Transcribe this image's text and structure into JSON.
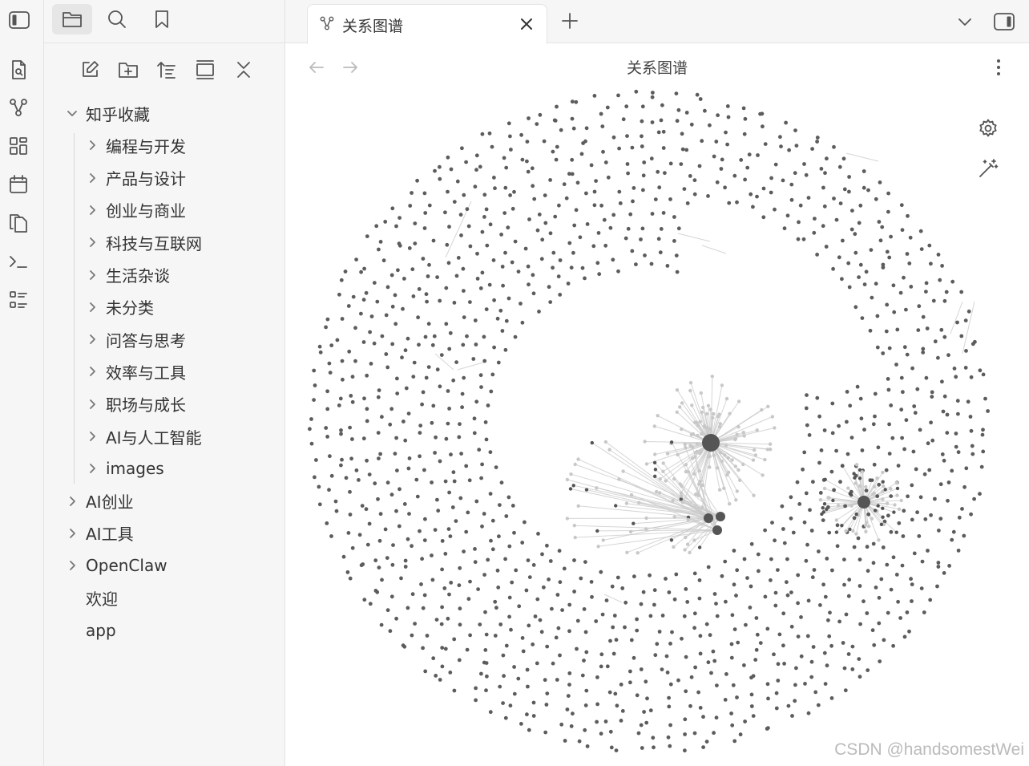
{
  "tab": {
    "title": "关系图谱"
  },
  "view": {
    "title": "关系图谱"
  },
  "sidebar": {
    "tabs": [
      {
        "icon": "folder-icon",
        "active": true
      },
      {
        "icon": "search-icon",
        "active": false
      },
      {
        "icon": "bookmark-icon",
        "active": false
      }
    ],
    "actions": [
      "new-note-icon",
      "new-folder-icon",
      "sort-icon",
      "collapse-view-icon",
      "collapse-all-icon"
    ],
    "tree": [
      {
        "label": "知乎收藏",
        "depth": 0,
        "expanded": true
      },
      {
        "label": "编程与开发",
        "depth": 1
      },
      {
        "label": "产品与设计",
        "depth": 1
      },
      {
        "label": "创业与商业",
        "depth": 1
      },
      {
        "label": "科技与互联网",
        "depth": 1
      },
      {
        "label": "生活杂谈",
        "depth": 1
      },
      {
        "label": "未分类",
        "depth": 1
      },
      {
        "label": "问答与思考",
        "depth": 1
      },
      {
        "label": "效率与工具",
        "depth": 1
      },
      {
        "label": "职场与成长",
        "depth": 1
      },
      {
        "label": "AI与人工智能",
        "depth": 1
      },
      {
        "label": "images",
        "depth": 1
      },
      {
        "label": "AI创业",
        "depth": 0
      },
      {
        "label": "AI工具",
        "depth": 0
      },
      {
        "label": "OpenClaw",
        "depth": 0
      },
      {
        "label": "欢迎",
        "depth": 0,
        "file": true
      },
      {
        "label": "app",
        "depth": 0,
        "file": true
      }
    ]
  },
  "ribbon": [
    "open-quick-switcher-icon",
    "graph-view-icon",
    "canvas-icon",
    "daily-note-icon",
    "templates-icon",
    "command-palette-icon",
    "outline-icon"
  ],
  "graph": {
    "node_color": "#5c5c5c",
    "link_color": "#c8c8c8",
    "settings_icon": "gear-icon",
    "animate_icon": "magic-wand-icon"
  },
  "watermark": "CSDN @handsomestWei"
}
